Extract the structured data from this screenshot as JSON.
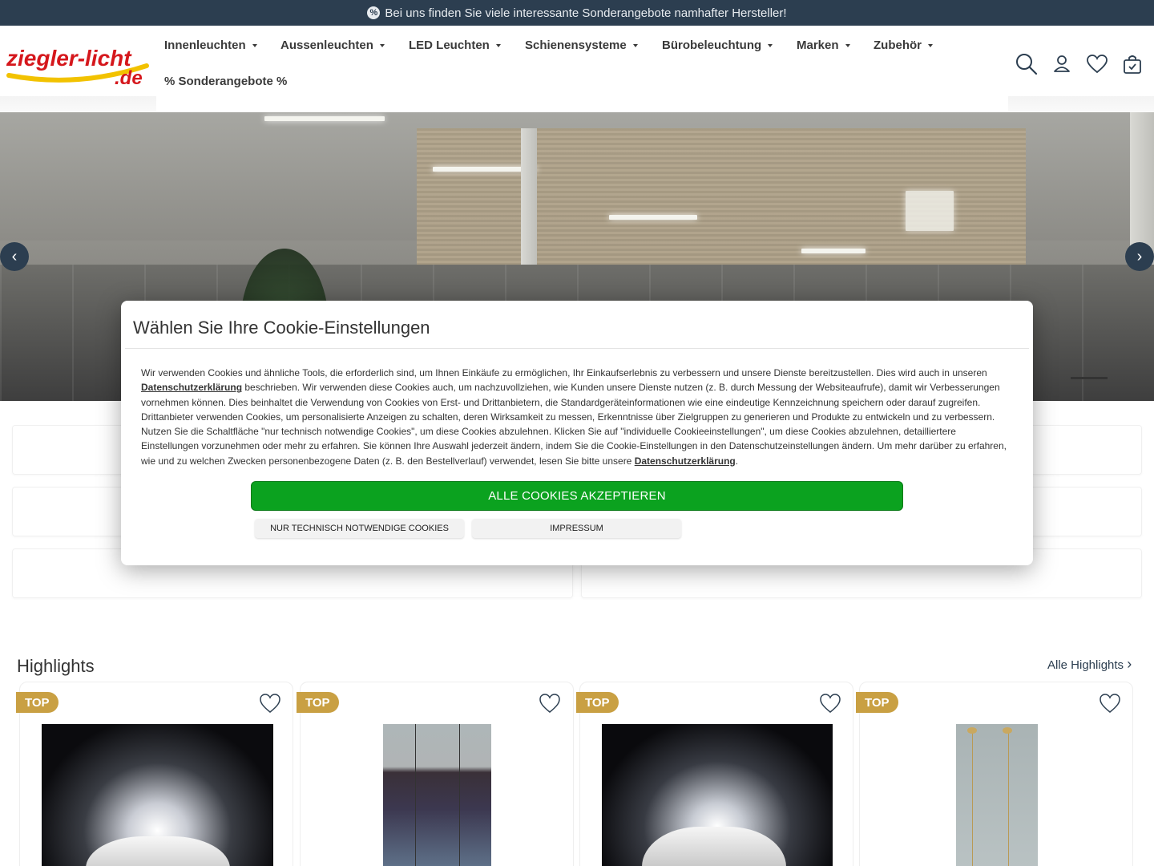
{
  "promo": {
    "icon": "percent-icon",
    "text": "Bei uns finden Sie viele interessante Sonderangebote namhafter Hersteller!"
  },
  "logo": {
    "main": "ziegler-licht",
    "tld": ".de"
  },
  "nav": {
    "items": [
      {
        "label": "Innenleuchten"
      },
      {
        "label": "Aussenleuchten"
      },
      {
        "label": "LED Leuchten"
      },
      {
        "label": "Schienensysteme"
      },
      {
        "label": "Bürobeleuchtung"
      },
      {
        "label": "Marken"
      },
      {
        "label": "Zubehör"
      }
    ],
    "special": "% Sonderangebote %"
  },
  "header_icons": [
    "search-icon",
    "account-icon",
    "wishlist-heart-icon",
    "cart-bag-icon"
  ],
  "hero": {
    "prev": "‹",
    "next": "›"
  },
  "highlights": {
    "title": "Highlights",
    "link": "Alle Highlights",
    "products": [
      {
        "badge": "TOP"
      },
      {
        "badge": "TOP"
      },
      {
        "badge": "TOP"
      },
      {
        "badge": "TOP"
      }
    ]
  },
  "cookie": {
    "title": "Wählen Sie Ihre Cookie-Einstellungen",
    "text_1": "Wir verwenden Cookies und ähnliche Tools, die erforderlich sind, um Ihnen Einkäufe zu ermöglichen, Ihr Einkaufserlebnis zu verbessern und unsere Dienste bereitzustellen. Dies wird auch in unseren ",
    "link_1": "Datenschutzerklärung",
    "text_2": " beschrieben. Wir verwenden diese Cookies auch, um nachzuvollziehen, wie Kunden unsere Dienste nutzen (z. B. durch Messung der Websiteaufrufe), damit wir Verbesserungen vornehmen können. Dies beinhaltet die Verwendung von Cookies von Erst- und Drittanbietern, die Standardgeräteinformationen wie eine eindeutige Kennzeichnung speichern oder darauf zugreifen. Drittanbieter verwenden Cookies, um personalisierte Anzeigen zu schalten, deren Wirksamkeit zu messen, Erkenntnisse über Zielgruppen zu generieren und Produkte zu entwickeln und zu verbessern. Nutzen Sie die Schaltfläche \"nur technisch notwendige Cookies\", um diese Cookies abzulehnen. Klicken Sie auf \"individuelle Cookieeinstellungen\", um diese Cookies abzulehnen, detailliertere Einstellungen vorzunehmen oder mehr zu erfahren. Sie können Ihre Auswahl jederzeit ändern, indem Sie die Cookie-Einstellungen in den Datenschutzeinstellungen ändern. Um mehr darüber zu erfahren, wie und zu welchen Zwecken personenbezogene Daten (z. B. den Bestellverlauf) verwendet, lesen Sie bitte unsere ",
    "link_2": "Datenschutzerklärung",
    "text_3": ".",
    "accept_label": "ALLE COOKIES AKZEPTIEREN",
    "necessary_label": "NUR TECHNISCH NOTWENDIGE COOKIES",
    "impressum_label": "IMPRESSUM"
  },
  "colors": {
    "header_bar": "#2c3e50",
    "accept": "#0ba21f",
    "badge": "#c9a043",
    "logo_red": "#d5171c",
    "logo_yellow": "#f2c200"
  }
}
